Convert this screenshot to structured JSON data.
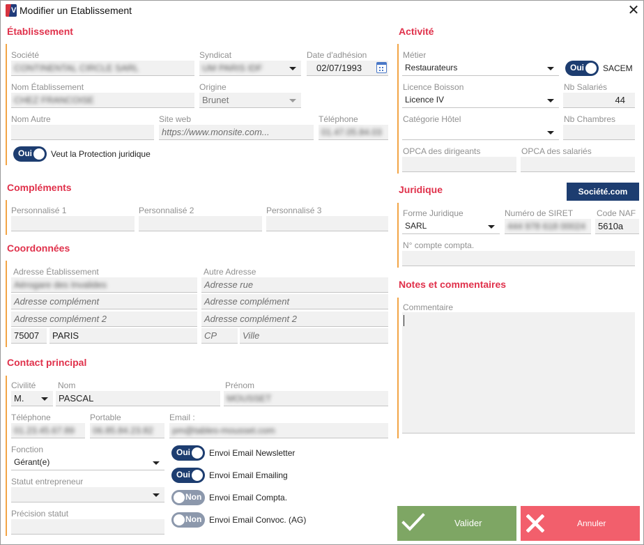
{
  "window": {
    "title": "Modifier un Etablissement",
    "close": "✕"
  },
  "etab": {
    "title": "Établissement",
    "societe_label": "Société",
    "societe_value": "CONTINENTAL CIRCLE SARL",
    "syndicat_label": "Syndicat",
    "syndicat_value": "UM PARIS IDF",
    "date_label": "Date d'adhésion",
    "date_value": "02/07/1993",
    "nom_label": "Nom Établissement",
    "nom_value": "CHEZ FRANCOISE",
    "origine_label": "Origine",
    "origine_value": "Brunet",
    "nomautre_label": "Nom Autre",
    "siteweb_label": "Site web",
    "siteweb_placeholder": "https://www.monsite.com...",
    "tel_label": "Téléphone",
    "tel_value": "01.47.05.84.03",
    "protection_toggle": "Oui",
    "protection_label": "Veut la Protection juridique"
  },
  "complements": {
    "title": "Compléments",
    "p1": "Personnalisé 1",
    "p2": "Personnalisé 2",
    "p3": "Personnalisé 3"
  },
  "coord": {
    "title": "Coordonnées",
    "adresse_label": "Adresse Établissement",
    "adresse_value": "Aérogare des Invalides",
    "autre_label": "Autre Adresse",
    "rue_ph": "Adresse rue",
    "comp_ph": "Adresse complément",
    "comp2_ph": "Adresse complément 2",
    "cp_value": "75007",
    "ville_value": "PARIS",
    "cp_ph": "CP",
    "ville_ph": "Ville"
  },
  "contact": {
    "title": "Contact principal",
    "civilite_label": "Civilité",
    "civilite_value": "M.",
    "nom_label": "Nom",
    "nom_value": "PASCAL",
    "prenom_label": "Prénom",
    "prenom_value": "MOUSSET",
    "tel_label": "Téléphone",
    "tel_value": "01.23.45.67.89",
    "portable_label": "Portable",
    "portable_value": "06.85.84.23.82",
    "email_label": "Email :",
    "email_value": "pm@tables-mousset.com",
    "fonction_label": "Fonction",
    "fonction_value": "Gérant(e)",
    "statut_label": "Statut entrepreneur",
    "precision_label": "Précision statut",
    "t1_state": "Oui",
    "t1_label": "Envoi Email Newsletter",
    "t2_state": "Oui",
    "t2_label": "Envoi Email Emailing",
    "t3_state": "Non",
    "t3_label": "Envoi Email Compta.",
    "t4_state": "Non",
    "t4_label": "Envoi Email Convoc. (AG)"
  },
  "activite": {
    "title": "Activité",
    "metier_label": "Métier",
    "metier_value": "Restaurateurs",
    "sacem_toggle": "Oui",
    "sacem_label": "SACEM",
    "licence_label": "Licence Boisson",
    "licence_value": "Licence IV",
    "nbsal_label": "Nb Salariés",
    "nbsal_value": "44",
    "cathotel_label": "Catégorie Hôtel",
    "nbch_label": "Nb Chambres",
    "opca_dir_label": "OPCA des dirigeants",
    "opca_sal_label": "OPCA des salariés"
  },
  "juridique": {
    "title": "Juridique",
    "societe_button": "Société.com",
    "forme_label": "Forme Juridique",
    "forme_value": "SARL",
    "siret_label": "Numéro de SIRET",
    "siret_value": "444 978 618 00024",
    "naf_label": "Code NAF",
    "naf_value": "5610a",
    "compte_label": "N° compte compta."
  },
  "notes": {
    "title": "Notes et commentaires",
    "comment_label": "Commentaire"
  },
  "actions": {
    "valider": "Valider",
    "annuler": "Annuler"
  },
  "colors": {
    "section_title": "#e0314b",
    "section_bar": "#f2a446",
    "toggle_on": "#1d3d70",
    "toggle_off": "#8c98ac",
    "valider": "#7ea664",
    "annuler": "#f25f6c",
    "societe_button": "#1d3d70"
  }
}
